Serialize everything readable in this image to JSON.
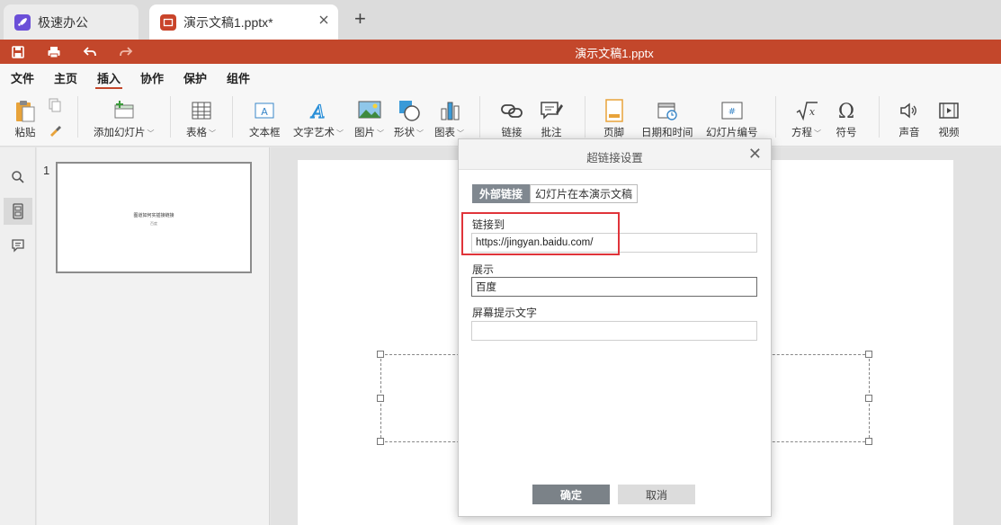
{
  "tabs": [
    {
      "label": "极速办公"
    },
    {
      "label": "演示文稿1.pptx*"
    }
  ],
  "newtab_label": "+",
  "window_title": "演示文稿1.pptx",
  "menu": [
    {
      "label": "文件"
    },
    {
      "label": "主页"
    },
    {
      "label": "插入"
    },
    {
      "label": "协作"
    },
    {
      "label": "保护"
    },
    {
      "label": "组件"
    }
  ],
  "ribbon": {
    "paste": "粘贴",
    "add_slide": "添加幻灯片",
    "table": "表格",
    "textbox": "文本框",
    "wordart": "文字艺术",
    "image": "图片",
    "shape": "形状",
    "chart": "图表",
    "link": "链接",
    "comment": "批注",
    "footer": "页脚",
    "datetime": "日期和时间",
    "slide_number": "幻灯片编号",
    "equation": "方程",
    "symbol": "符号",
    "audio": "声音",
    "video": "视频"
  },
  "slide_thumb": {
    "number": "1",
    "title": "图道如何实插接链接",
    "subtitle": "百度"
  },
  "dialog": {
    "title": "超链接设置",
    "close": "✕",
    "seg_external": "外部链接",
    "seg_internal": "幻灯片在本演示文稿",
    "link_label": "链接到",
    "link_value": "https://jingyan.baidu.com/",
    "display_label": "展示",
    "display_value": "百度",
    "tooltip_label": "屏幕提示文字",
    "tooltip_value": "",
    "ok": "确定",
    "cancel": "取消"
  },
  "colors": {
    "accent": "#c3472b",
    "highlight": "#e0343a"
  }
}
